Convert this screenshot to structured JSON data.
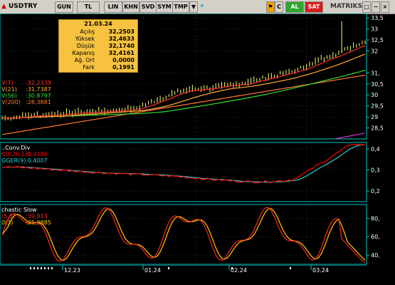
{
  "toolbar": {
    "symbol": "USDTRY",
    "buttons": [
      "GUN",
      "TL",
      "LIN",
      "KHN",
      "SVD",
      "SYM",
      "TMP"
    ],
    "brand": "MATRIKS",
    "buy": "AL",
    "sell": "SAT",
    "right_buttons": [
      "C",
      "□",
      "−",
      "×"
    ]
  },
  "colors": {
    "price_bar": "#ffff66",
    "ma7": "#ff3030",
    "ma21": "#ffaa33",
    "ma56": "#33dd33",
    "ma200": "#ff7733",
    "macd": "#ff0000",
    "signal": "#33cccc",
    "stoch_k": "#ff2222",
    "stoch_d": "#ffcc00",
    "axis": "#00cccc",
    "grid": "#333333"
  },
  "tooltip": {
    "date": "21.03.24",
    "rows": [
      {
        "label": "Açılış",
        "value": "32,2503"
      },
      {
        "label": "Yüksek",
        "value": "32,4633"
      },
      {
        "label": "Düşük",
        "value": "32,1740"
      },
      {
        "label": "Kapanış",
        "value": "32,4161"
      },
      {
        "label": "Ağ. Ort",
        "value": "0,0000"
      },
      {
        "label": "Fark",
        "value": "0,1991"
      }
    ]
  },
  "chart_data": [
    {
      "type": "line",
      "legend": [
        {
          "text": "V(7)",
          "value": ":32,2339"
        },
        {
          "text": "V(21)",
          "value": ":31,7387"
        },
        {
          "text": "V(56)",
          "value": ":30,8797"
        },
        {
          "text": "V(200)",
          "value": ":28,3881"
        }
      ],
      "y_ticks": [
        "33,5",
        "33",
        "32,5",
        "32",
        "31,",
        "30,5",
        "30",
        "29,5",
        "29",
        "28,5"
      ],
      "ylim": [
        28,
        33.7
      ]
    },
    {
      "type": "line",
      "title": "..Conv.Div",
      "legend": [
        {
          "text": "CD(26,12)",
          "value": ":0,4186"
        },
        {
          "text": "GGER(9)",
          "value": ":0,4007"
        }
      ],
      "y_ticks": [
        "0,4",
        "0,3",
        "0,2"
      ],
      "ylim": [
        0.15,
        0.43
      ]
    },
    {
      "type": "line",
      "title": "chastic Slow",
      "legend": [
        {
          "text": "(5,5)",
          "value": ":39,913"
        },
        {
          "text": "0(3)",
          "value": ":35,9885"
        }
      ],
      "y_ticks": [
        "80,",
        "60,",
        "40,"
      ],
      "ylim": [
        30,
        95
      ]
    }
  ],
  "x_axis": {
    "labels": [
      "12.23",
      "01.24",
      "02.24",
      "03.24"
    ]
  }
}
